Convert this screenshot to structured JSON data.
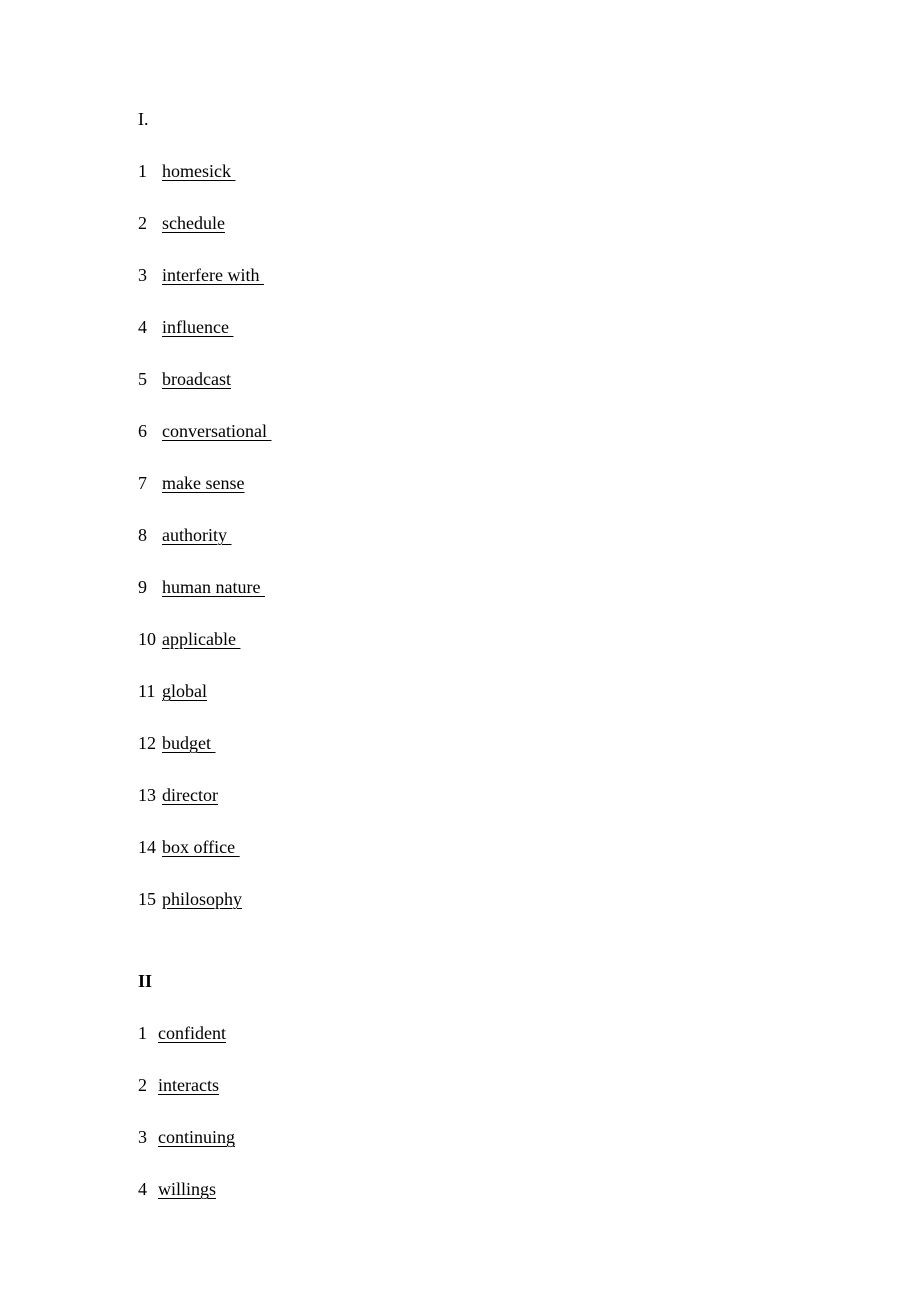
{
  "document": {
    "background_color": "#ffffff",
    "text_color": "#000000"
  },
  "sections": [
    {
      "id": "section-1",
      "heading": "I.",
      "heading_style": "regular",
      "items": [
        {
          "number": "1",
          "answer": "homesick "
        },
        {
          "number": "2",
          "answer": "schedule"
        },
        {
          "number": "3",
          "answer": "interfere with "
        },
        {
          "number": "4",
          "answer": "influence "
        },
        {
          "number": "5",
          "answer": "broadcast"
        },
        {
          "number": "6",
          "answer": "conversational "
        },
        {
          "number": "7",
          "answer": "make sense"
        },
        {
          "number": "8",
          "answer": "authority "
        },
        {
          "number": "9",
          "answer": "human nature "
        },
        {
          "number": "10",
          "answer": "applicable "
        },
        {
          "number": "11",
          "answer": "global"
        },
        {
          "number": "12",
          "answer": "budget "
        },
        {
          "number": "13",
          "answer": "director"
        },
        {
          "number": "14",
          "answer": "box office "
        },
        {
          "number": "15",
          "answer": "philosophy"
        }
      ]
    },
    {
      "id": "section-2",
      "heading": "II",
      "heading_style": "bold",
      "items": [
        {
          "number": "1",
          "answer": "confident"
        },
        {
          "number": "2",
          "answer": "interacts"
        },
        {
          "number": "3",
          "answer": "continuing"
        },
        {
          "number": "4",
          "answer": "willings"
        }
      ]
    }
  ]
}
